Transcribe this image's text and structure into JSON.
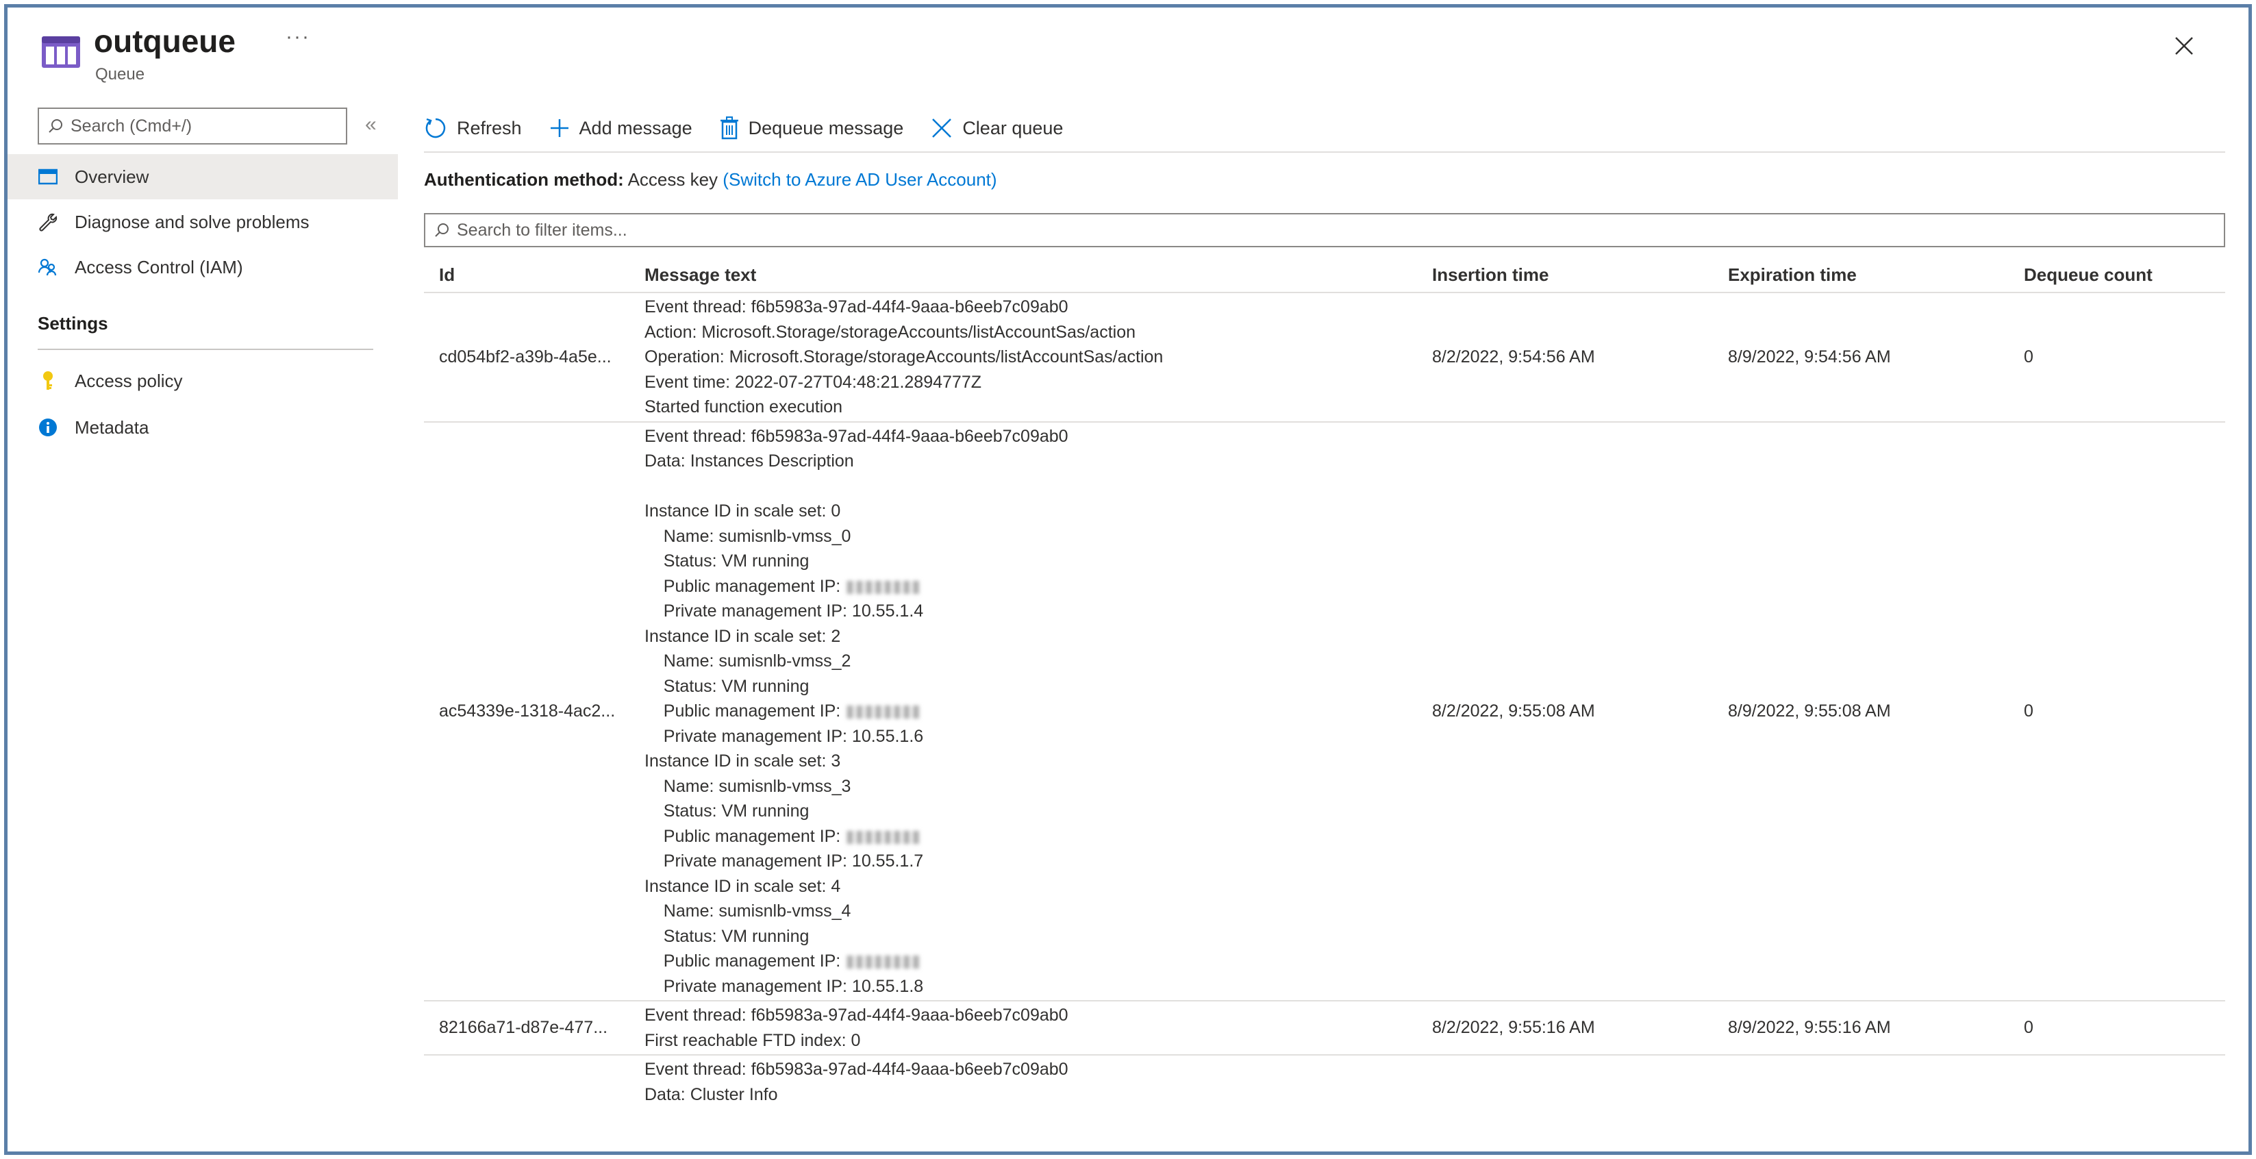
{
  "header": {
    "title": "outqueue",
    "subtitle": "Queue",
    "more": "···"
  },
  "sidebar": {
    "search_placeholder": "Search (Cmd+/)",
    "collapse": "«",
    "items": [
      {
        "label": "Overview"
      },
      {
        "label": "Diagnose and solve problems"
      },
      {
        "label": "Access Control (IAM)"
      }
    ],
    "settings_title": "Settings",
    "settings_items": [
      {
        "label": "Access policy"
      },
      {
        "label": "Metadata"
      }
    ]
  },
  "toolbar": {
    "refresh": "Refresh",
    "add_message": "Add message",
    "dequeue_message": "Dequeue message",
    "clear_queue": "Clear queue"
  },
  "auth": {
    "label": "Authentication method:",
    "value": "Access key",
    "link": "(Switch to Azure AD User Account)"
  },
  "filter_placeholder": "Search to filter items...",
  "table": {
    "headers": [
      "Id",
      "Message text",
      "Insertion time",
      "Expiration time",
      "Dequeue count"
    ],
    "rows": [
      {
        "id": "cd054bf2-a39b-4a5e...",
        "message": [
          "Event thread: f6b5983a-97ad-44f4-9aaa-b6eeb7c09ab0",
          "Action: Microsoft.Storage/storageAccounts/listAccountSas/action",
          "Operation: Microsoft.Storage/storageAccounts/listAccountSas/action",
          "Event time: 2022-07-27T04:48:21.2894777Z",
          "Started function execution"
        ],
        "insertion": "8/2/2022, 9:54:56 AM",
        "expiration": "8/9/2022, 9:54:56 AM",
        "dequeue": "0"
      },
      {
        "id": "ac54339e-1318-4ac2...",
        "message": [
          "Event thread: f6b5983a-97ad-44f4-9aaa-b6eeb7c09ab0",
          "Data: Instances Description",
          "",
          "Instance ID in scale set: 0",
          "    Name: sumisnlb-vmss_0",
          "    Status: VM running",
          "    Public management IP: ",
          "    Private management IP: 10.55.1.4",
          "Instance ID in scale set: 2",
          "    Name: sumisnlb-vmss_2",
          "    Status: VM running",
          "    Public management IP: ",
          "    Private management IP: 10.55.1.6",
          "Instance ID in scale set: 3",
          "    Name: sumisnlb-vmss_3",
          "    Status: VM running",
          "    Public management IP: ",
          "    Private management IP: 10.55.1.7",
          "Instance ID in scale set: 4",
          "    Name: sumisnlb-vmss_4",
          "    Status: VM running",
          "    Public management IP: ",
          "    Private management IP: 10.55.1.8"
        ],
        "insertion": "8/2/2022, 9:55:08 AM",
        "expiration": "8/9/2022, 9:55:08 AM",
        "dequeue": "0"
      },
      {
        "id": "82166a71-d87e-477...",
        "message": [
          "Event thread: f6b5983a-97ad-44f4-9aaa-b6eeb7c09ab0",
          "First reachable FTD index: 0"
        ],
        "insertion": "8/2/2022, 9:55:16 AM",
        "expiration": "8/9/2022, 9:55:16 AM",
        "dequeue": "0"
      },
      {
        "id": "",
        "message": [
          "Event thread: f6b5983a-97ad-44f4-9aaa-b6eeb7c09ab0",
          "Data: Cluster Info"
        ],
        "insertion": "",
        "expiration": "",
        "dequeue": ""
      }
    ]
  },
  "colors": {
    "accent": "#0078d4",
    "queue_icon": "#7b5cc7",
    "key_icon": "#f2c811",
    "info_icon": "#0078d4",
    "frame_border": "#5b7fa8"
  }
}
